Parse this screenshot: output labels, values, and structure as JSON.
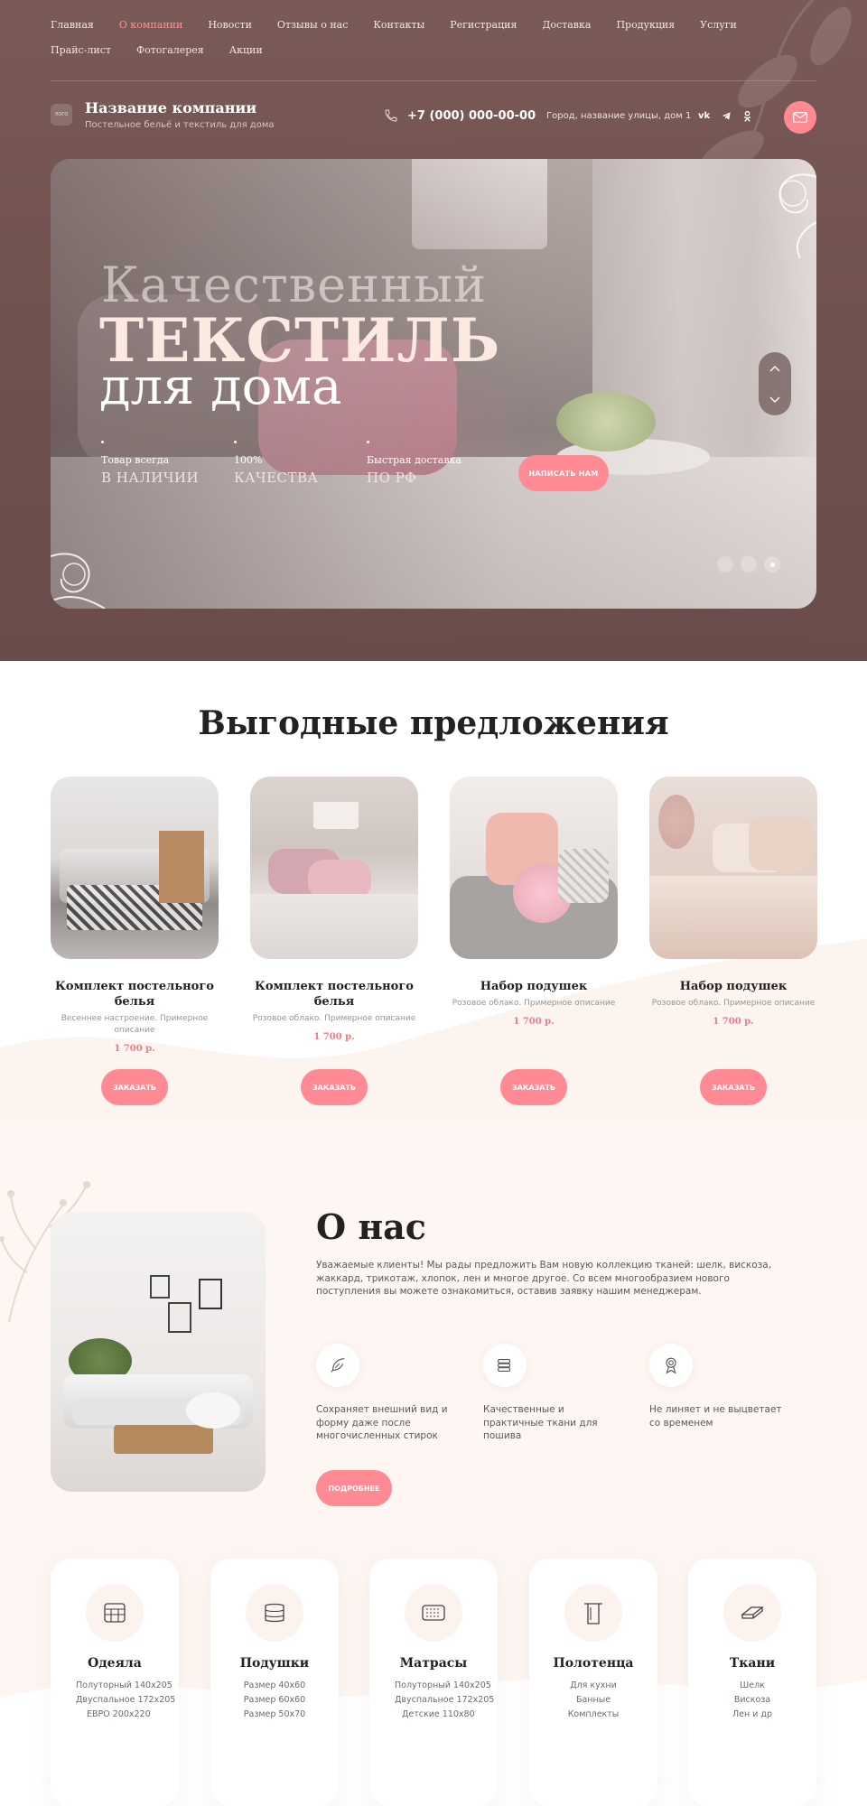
{
  "nav": {
    "items": [
      "Главная",
      "О компании",
      "Новости",
      "Отзывы о нас",
      "Контакты",
      "Регистрация",
      "Доставка",
      "Продукция",
      "Услуги",
      "Прайс-лист",
      "Фотогалерея",
      "Акции"
    ],
    "active_index": 1
  },
  "brand": {
    "logo_text": "ЛОГО",
    "name": "Название компании",
    "subtitle": "Постельное бельё и текстиль для дома"
  },
  "contacts": {
    "phone": "+7 (000) 000-00-00",
    "address": "Город, название улицы, дом 1",
    "socials": [
      "vk-icon",
      "telegram-icon",
      "odnoklassniki-icon"
    ]
  },
  "hero": {
    "line1": "Качественный",
    "line2": "ТЕКСТИЛЬ",
    "line3": "для дома",
    "features": [
      {
        "top": "Товар всегда",
        "bottom": "В НАЛИЧИИ"
      },
      {
        "top": "100%",
        "bottom": "КАЧЕСТВА"
      },
      {
        "top": "Быстрая доставка",
        "bottom": "ПО РФ"
      }
    ],
    "cta": "НАПИСАТЬ НАМ",
    "slides": 3,
    "active_slide": 3
  },
  "offers": {
    "title": "Выгодные предложения",
    "button": "ЗАКАЗАТЬ",
    "items": [
      {
        "name": "Комплект постельного белья",
        "desc": "Весеннее настроение. Примерное описание",
        "price": "1 700 р."
      },
      {
        "name": "Комплект постельного белья",
        "desc": "Розовое облако. Примерное описание",
        "price": "1 700 р."
      },
      {
        "name": "Набор подушек",
        "desc": "Розовое облако. Примерное описание",
        "price": "1 700 р."
      },
      {
        "name": "Набор подушек",
        "desc": "Розовое облако. Примерное описание",
        "price": "1 700 р."
      }
    ]
  },
  "about": {
    "title": "О нас",
    "text": "Уважаемые клиенты! Мы рады предложить Вам новую коллекцию тканей: шелк, вискоза, жаккард, трикотаж, хлопок, лен и многое другое. Со всем многообразием нового поступления вы можете ознакомиться, оставив заявку нашим менеджерам.",
    "features": [
      {
        "icon": "feather-icon",
        "text": "Сохраняет внешний вид и форму даже после многочисленных стирок"
      },
      {
        "icon": "fabric-stack-icon",
        "text": "Качественные и практичные ткани для пошива"
      },
      {
        "icon": "quality-badge-icon",
        "text": "Не линяет и не выцветает со временем"
      }
    ],
    "button": "ПОДРОБНЕЕ"
  },
  "categories": [
    {
      "icon": "blanket-icon",
      "name": "Одеяла",
      "items": [
        "Полуторный 140х205",
        "Двуспальное 172х205",
        "ЕВРО 200х220"
      ]
    },
    {
      "icon": "pillow-icon",
      "name": "Подушки",
      "items": [
        "Размер 40х60",
        "Размер 60х60",
        "Размер 50х70"
      ]
    },
    {
      "icon": "mattress-icon",
      "name": "Матрасы",
      "items": [
        "Полуторный 140х205",
        "Двуспальное 172х205",
        "Детские 110х80"
      ]
    },
    {
      "icon": "towel-icon",
      "name": "Полотенца",
      "items": [
        "Для кухни",
        "Банные",
        "Комплекты"
      ]
    },
    {
      "icon": "fabric-icon",
      "name": "Ткани",
      "items": [
        "Шелк",
        "Вискоза",
        "Лен и др"
      ]
    }
  ],
  "colors": {
    "accent": "#ff8a94",
    "header_bg": "#7a5a57",
    "price": "#ef7c86",
    "section_bg": "#fdf6f2"
  }
}
